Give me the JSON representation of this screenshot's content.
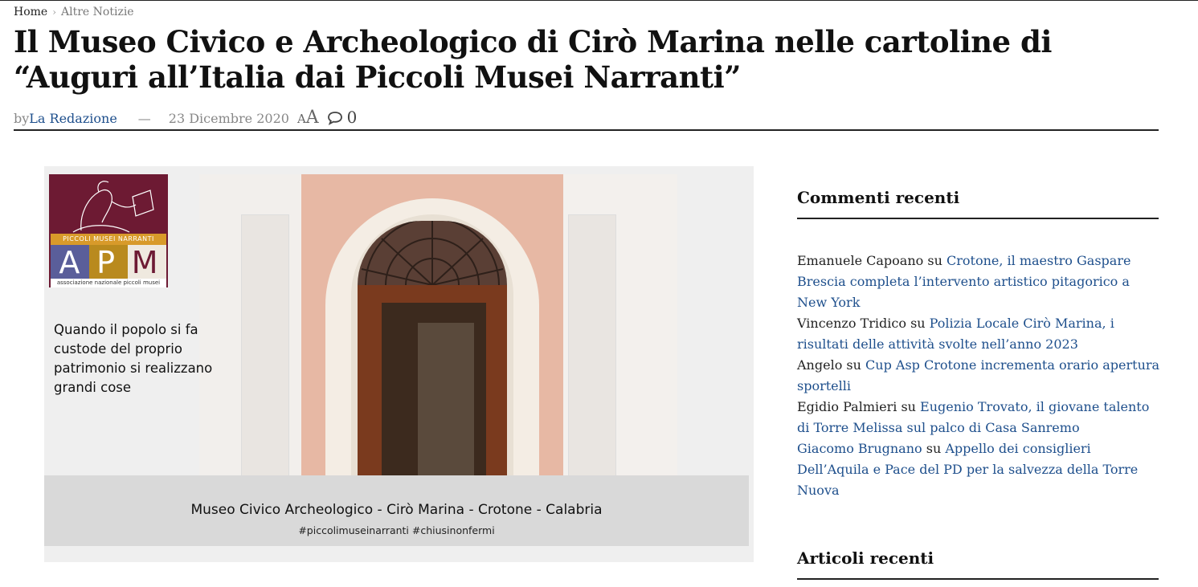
{
  "breadcrumb": {
    "home": "Home",
    "separator": "›",
    "current": "Altre Notizie"
  },
  "article": {
    "title": "Il Museo Civico e Archeologico di Cirò Marina nelle cartoline di “Auguri all’Italia dai Piccoli Musei Narranti”",
    "by_label": "by",
    "author": "La Redazione",
    "dash": "—",
    "date": "23 Dicembre 2020",
    "font_small": "A",
    "font_big": "A",
    "comment_count": "0"
  },
  "feature_image": {
    "logo_band": "PICCOLI MUSEI NARRANTI",
    "logo_letters": [
      "A",
      "P",
      "M"
    ],
    "logo_sub": "associazione nazionale piccoli musei",
    "quote": "Quando il popolo si fa custode del proprio patrimonio si realizzano grandi cose",
    "caption": "Museo Civico Archeologico - Cirò Marina - Crotone - Calabria",
    "hashtags": "#piccolimuseinarranti #chiusinonfermi"
  },
  "sidebar": {
    "recent_comments_title": "Commenti recenti",
    "recent_comments": [
      {
        "author": "Emanuele Capoano",
        "on": "su",
        "post": "Crotone, il maestro Gaspare Brescia completa l’intervento artistico pitagorico a New York"
      },
      {
        "author": "Vincenzo Tridico",
        "on": "su",
        "post": "Polizia Locale Cirò Marina, i risultati delle attività svolte nell’anno 2023"
      },
      {
        "author": "Angelo",
        "on": "su",
        "post": "Cup Asp Crotone incrementa orario apertura sportelli"
      },
      {
        "author": "Egidio Palmieri",
        "on": "su",
        "post": "Eugenio Trovato, il giovane talento di Torre Melissa sul palco di Casa Sanremo"
      },
      {
        "author": "Giacomo Brugnano",
        "on": "su",
        "post": "Appello dei consiglieri Dell’Aquila e Pace del PD per la salvezza della Torre Nuova",
        "author_is_link": true
      }
    ],
    "recent_articles_title": "Articoli recenti"
  },
  "colors": {
    "link": "#1e4f8c",
    "logo_maroon": "#6d1a33",
    "logo_gold": "#d89a2a"
  }
}
